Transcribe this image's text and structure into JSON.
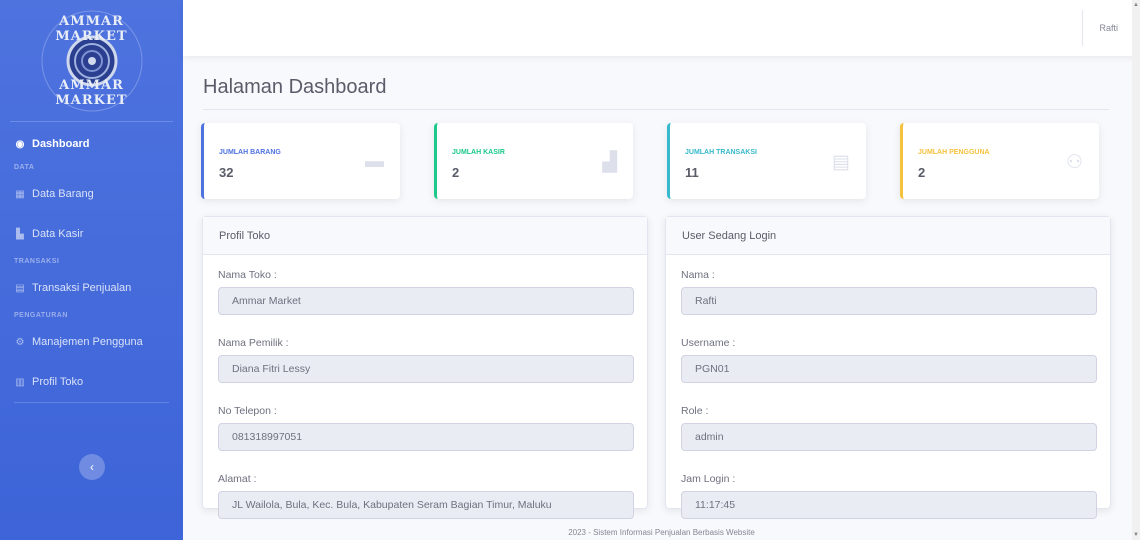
{
  "brand": {
    "name_top": "AMMAR MARKET",
    "name_bottom": "AMMAR MARKET"
  },
  "sidebar": {
    "items": [
      {
        "key": "dashboard",
        "label": "Dashboard",
        "icon": "tachometer-icon",
        "active": true
      },
      {
        "heading": "DATA"
      },
      {
        "key": "data-barang",
        "label": "Data Barang",
        "icon": "table-icon"
      },
      {
        "key": "data-kasir",
        "label": "Data Kasir",
        "icon": "user-icon"
      },
      {
        "heading": "TRANSAKSI"
      },
      {
        "key": "transaksi-penjualan",
        "label": "Transaksi Penjualan",
        "icon": "file-icon"
      },
      {
        "heading": "PENGATURAN"
      },
      {
        "key": "manajemen-pengguna",
        "label": "Manajemen Pengguna",
        "icon": "users-icon"
      },
      {
        "key": "profil-toko",
        "label": "Profil Toko",
        "icon": "store-icon"
      }
    ],
    "toggle_icon": "chevron-left-icon"
  },
  "topbar": {
    "user_name": "Rafti"
  },
  "main": {
    "title": "Halaman Dashboard",
    "stats": [
      {
        "label": "JUMLAH BARANG",
        "value": "32",
        "color": "#4e73df",
        "icon": "box-icon"
      },
      {
        "label": "JUMLAH KASIR",
        "value": "2",
        "color": "#1cc88a",
        "icon": "cash-register-icon"
      },
      {
        "label": "JUMLAH TRANSAKSI",
        "value": "11",
        "color": "#36b9cc",
        "icon": "receipt-icon"
      },
      {
        "label": "JUMLAH PENGGUNA",
        "value": "2",
        "color": "#f6c23e",
        "icon": "users-icon"
      }
    ],
    "profil_toko": {
      "header": "Profil Toko",
      "fields": [
        {
          "label": "Nama Toko :",
          "value": "Ammar Market"
        },
        {
          "label": "Nama Pemilik :",
          "value": "Diana Fitri Lessy"
        },
        {
          "label": "No Telepon :",
          "value": "081318997051"
        },
        {
          "label": "Alamat :",
          "value": "JL Wailola, Bula, Kec. Bula, Kabupaten Seram Bagian Timur, Maluku"
        }
      ]
    },
    "user_login": {
      "header": "User Sedang Login",
      "fields": [
        {
          "label": "Nama :",
          "value": "Rafti"
        },
        {
          "label": "Username :",
          "value": "PGN01"
        },
        {
          "label": "Role :",
          "value": "admin"
        },
        {
          "label": "Jam Login :",
          "value": "11:17:45"
        }
      ]
    }
  },
  "footer": {
    "text": "2023 - Sistem Informasi Penjualan Berbasis Website"
  }
}
